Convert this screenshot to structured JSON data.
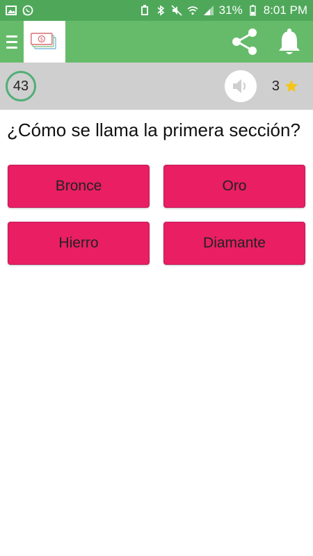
{
  "status_bar": {
    "battery_percent": "31%",
    "time": "8:01 PM",
    "icons": [
      "image-icon",
      "whatsapp-icon",
      "usb-icon",
      "bluetooth-icon",
      "mute-icon",
      "wifi-icon",
      "signal-icon",
      "battery-icon"
    ]
  },
  "app_bar": {
    "menu_icon": "hamburger-icon",
    "logo_icon": "money-logo-icon",
    "share_icon": "share-icon",
    "bell_icon": "bell-icon",
    "background_color": "#66bb6a"
  },
  "info_bar": {
    "timer": "43",
    "sound_icon": "speaker-icon",
    "stars": "3",
    "star_icon": "star-icon"
  },
  "question": {
    "text": "¿Cómo se llama la primera sección?"
  },
  "answers": [
    {
      "label": "Bronce"
    },
    {
      "label": "Oro"
    },
    {
      "label": "Hierro"
    },
    {
      "label": "Diamante"
    }
  ],
  "colors": {
    "answer_button": "#e91e63",
    "timer_ring": "#4fae75",
    "star": "#f5c518"
  }
}
